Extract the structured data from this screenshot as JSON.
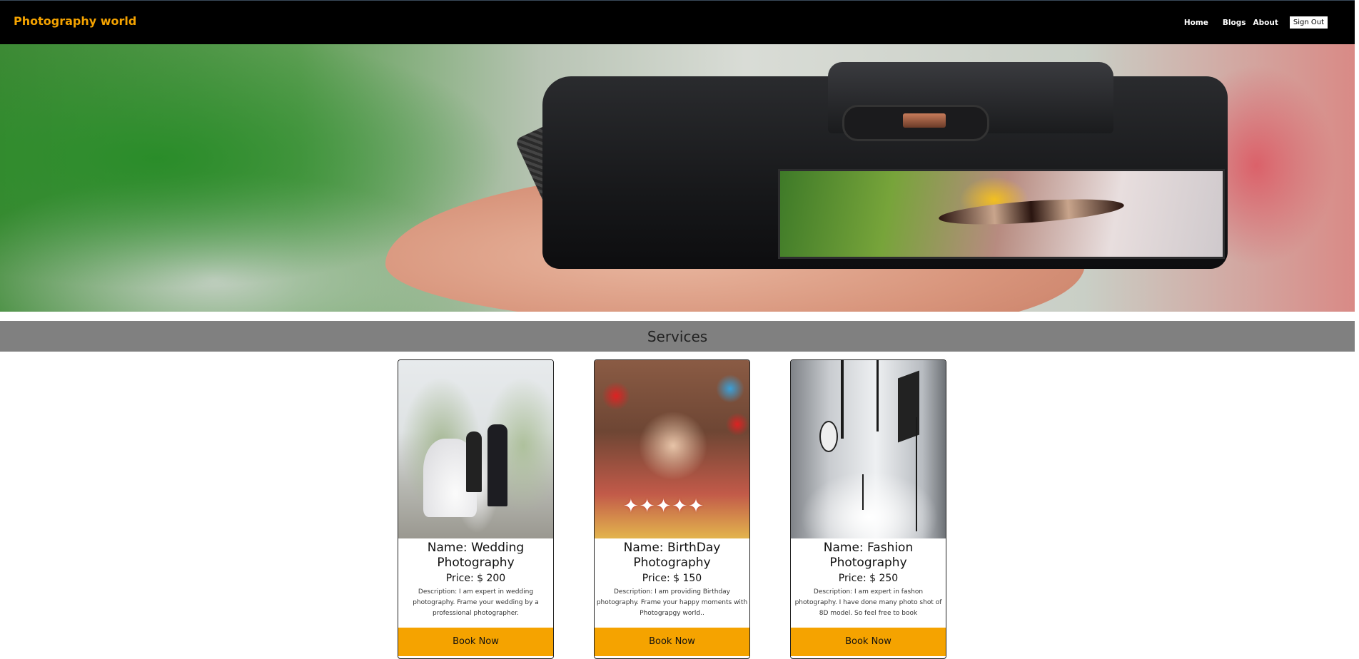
{
  "navbar": {
    "brand": "Photography world",
    "links": [
      "Home",
      "Blogs",
      "About"
    ],
    "sign_out": "Sign Out"
  },
  "colors": {
    "brand": "#f5a300",
    "navbar_bg": "#000000",
    "services_band": "#808080",
    "book_button": "#f5a300"
  },
  "services": {
    "title": "Services",
    "cards": [
      {
        "name": "Name: Wedding Photography",
        "price": "Price: $ 200",
        "description": "Description: I am expert in wedding photography. Frame your wedding by a professional photographer.",
        "button": "Book Now"
      },
      {
        "name": "Name: BirthDay Photography",
        "price": "Price: $ 150",
        "description": "Description: I am providing Birthday photography. Frame your happy moments with Photograpgy world..",
        "button": "Book Now"
      },
      {
        "name": "Name: Fashion Photography",
        "price": "Price: $ 250",
        "description": "Description: I am expert in fashon photography. I have done many photo shot of 8D model. So feel free to book",
        "button": "Book Now"
      }
    ]
  }
}
